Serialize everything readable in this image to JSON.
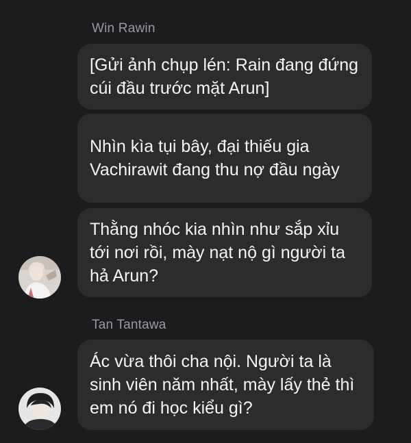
{
  "messages": [
    {
      "sender": "Win Rawin",
      "bubbles": [
        "[Gửi ảnh chụp lén: Rain đang đứng cúi đầu trước mặt Arun]",
        "Nhìn kìa tụi bây, đại thiếu gia Vachirawit đang thu nợ đầu ngày",
        "Thằng nhóc kia nhìn như sắp xỉu tới nơi rồi, mày nạt nộ gì người ta hả Arun?"
      ]
    },
    {
      "sender": "Tan Tantawa",
      "bubbles": [
        "Ác vừa thôi cha nội. Người ta là sinh viên năm nhất, mày lấy thẻ thì em nó đi học kiểu gì?"
      ]
    }
  ],
  "colors": {
    "background": "#1c1c1e",
    "bubble": "#2c2c2e",
    "sender_name": "#9a9aa0",
    "text": "#f5f5f7"
  }
}
